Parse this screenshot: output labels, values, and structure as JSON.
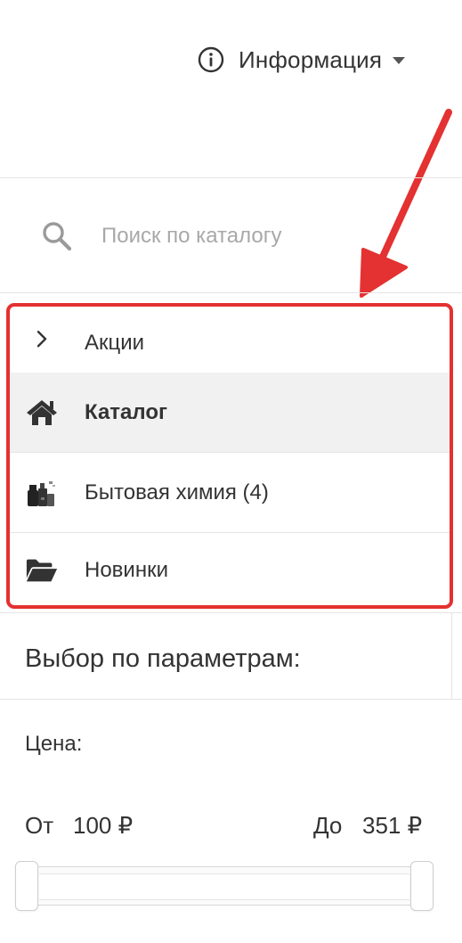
{
  "header": {
    "info_label": "Информация",
    "info_icon": "info-circle-icon",
    "caret_icon": "caret-down-icon"
  },
  "search": {
    "placeholder": "Поиск по каталогу",
    "icon": "search-icon"
  },
  "menu": {
    "items": [
      {
        "label": "Акции",
        "icon": "chevron-right-icon",
        "active": false
      },
      {
        "label": "Каталог",
        "icon": "home-icon",
        "active": true
      },
      {
        "label": "Бытовая химия (4)",
        "icon": "household-chemicals-icon",
        "active": false
      },
      {
        "label": "Новинки",
        "icon": "folder-open-icon",
        "active": false
      }
    ],
    "highlight_color": "#e43131"
  },
  "annotation": {
    "arrow_color": "#e43131"
  },
  "filter": {
    "title": "Выбор по параметрам:",
    "price_label": "Цена:",
    "from_label": "От",
    "from_value": "100 ₽",
    "to_label": "До",
    "to_value": "351 ₽",
    "slider_min_position": 0,
    "slider_max_position": 1
  }
}
